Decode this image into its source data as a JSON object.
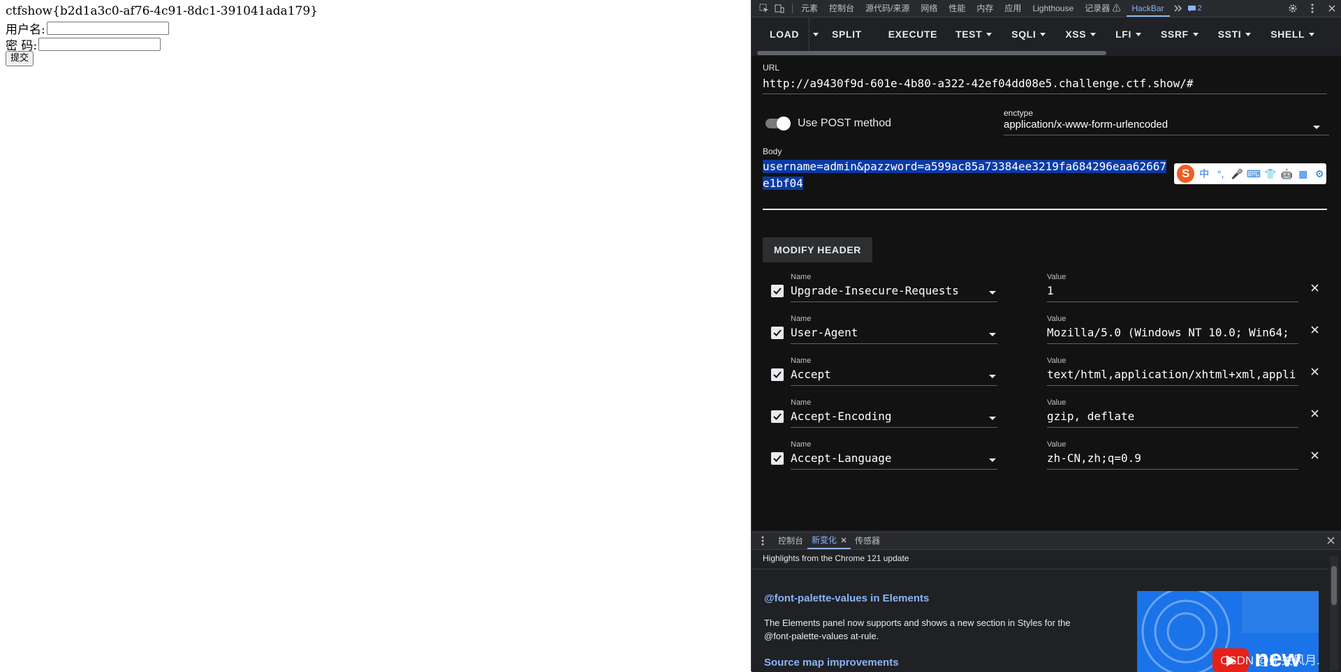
{
  "page": {
    "flag": "ctfshow{b2d1a3c0-af76-4c91-8dc1-391041ada179}",
    "username_label": "用户名:",
    "password_label": "密 码:",
    "submit_label": "提交",
    "username_value": "",
    "password_value": ""
  },
  "devtools": {
    "tabs": [
      "元素",
      "控制台",
      "源代码/来源",
      "网络",
      "性能",
      "内存",
      "应用",
      "Lighthouse",
      "记录器 ⚠",
      "HackBar"
    ],
    "active_tab": "HackBar",
    "issues_count": "2",
    "icons": [
      "inspect-icon",
      "device-toggle-icon",
      "more-tabs-icon",
      "settings-icon",
      "kebab-menu-icon",
      "close-icon"
    ]
  },
  "hackbar": {
    "toolbar": {
      "load": "LOAD",
      "split": "SPLIT",
      "execute": "EXECUTE",
      "test": "TEST",
      "sqli": "SQLI",
      "xss": "XSS",
      "lfi": "LFI",
      "ssrf": "SSRF",
      "ssti": "SSTI",
      "shell": "SHELL"
    },
    "url_label": "URL",
    "url_value": "http://a9430f9d-601e-4b80-a322-42ef04dd08e5.challenge.ctf.show/#",
    "post_method_label": "Use POST method",
    "post_method_enabled": true,
    "enctype_label": "enctype",
    "enctype_value": "application/x-www-form-urlencoded",
    "body_label": "Body",
    "body_line1": "username=admin&pazzword=a599ac85a73384ee3219fa684296eaa62667",
    "body_line2": "e1bf04",
    "modify_header_label": "MODIFY HEADER",
    "headers": [
      {
        "name_label": "Name",
        "value_label": "Value",
        "name": "Upgrade-Insecure-Requests",
        "value": "1",
        "checked": true
      },
      {
        "name_label": "Name",
        "value_label": "Value",
        "name": "User-Agent",
        "value": "Mozilla/5.0 (Windows NT 10.0; Win64;",
        "checked": true
      },
      {
        "name_label": "Name",
        "value_label": "Value",
        "name": "Accept",
        "value": "text/html,application/xhtml+xml,appli",
        "checked": true
      },
      {
        "name_label": "Name",
        "value_label": "Value",
        "name": "Accept-Encoding",
        "value": "gzip, deflate",
        "checked": true
      },
      {
        "name_label": "Name",
        "value_label": "Value",
        "name": "Accept-Language",
        "value": "zh-CN,zh;q=0.9",
        "checked": true
      }
    ]
  },
  "ime": {
    "logo": "S",
    "items": [
      "中",
      "°,",
      "🎤",
      "⌨",
      "👕",
      "🤖",
      "▦",
      "⚙"
    ]
  },
  "drawer": {
    "tabs": [
      "控制台",
      "新变化",
      "传感器"
    ],
    "active_tab": "新变化",
    "subtitle": "Highlights from the Chrome 121 update",
    "item1_title": "@font-palette-values in Elements",
    "item1_text": "The Elements panel now supports and shows a new section in Styles for the @font-palette-values at-rule.",
    "item2_title": "Source map improvements",
    "promo_word": "new"
  },
  "watermark": "CSDN @无关风月."
}
